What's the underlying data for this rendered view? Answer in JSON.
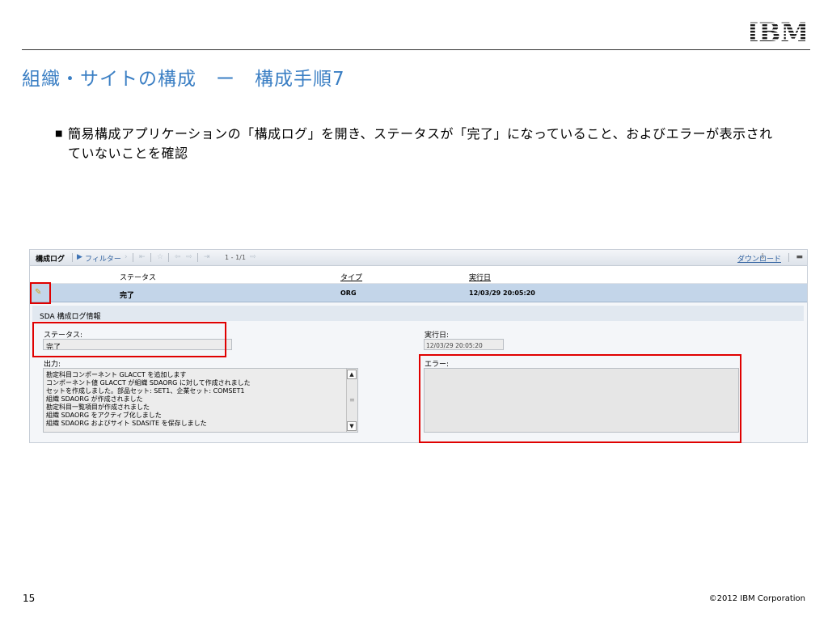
{
  "slide": {
    "logo": "IBM",
    "title": "組織・サイトの構成　ー　構成手順7",
    "bullet": "簡易構成アプリケーションの「構成ログ」を開き、ステータスが「完了」になっていること、およびエラーが表示されていないことを確認",
    "page_number": "15",
    "copyright": "©2012 IBM Corporation",
    "accent_color": "#3b7fc4",
    "highlight_color": "#e00000"
  },
  "app": {
    "toolbar": {
      "title": "構成ログ",
      "filter": "フィルター",
      "count": "1 - 1/1",
      "download": "ダウンロード"
    },
    "columns": {
      "status": "ステータス",
      "type": "タイプ",
      "date": "実行日"
    },
    "row": {
      "status": "完了",
      "type": "ORG",
      "date": "12/03/29 20:05:20"
    },
    "detail": {
      "header": "SDA 構成ログ情報",
      "status_label": "ステータス:",
      "status_value": "完了",
      "date_label": "実行日:",
      "date_value": "12/03/29 20:05:20",
      "output_label": "出力:",
      "output_lines": [
        "勘定科目コンポーネント GLACCT を追加します",
        "コンポーネント値 GLACCT が組織 SDAORG に対して作成されました",
        "セットを作成しました。部品セット: SET1、企業セット: COMSET1",
        "組織 SDAORG が作成されました",
        "勘定科目一覧項目が作成されました",
        "組織 SDAORG をアクティブ化しました",
        "組織 SDAORG およびサイト SDASITE を保存しました"
      ],
      "error_label": "エラー:",
      "error_value": ""
    }
  }
}
